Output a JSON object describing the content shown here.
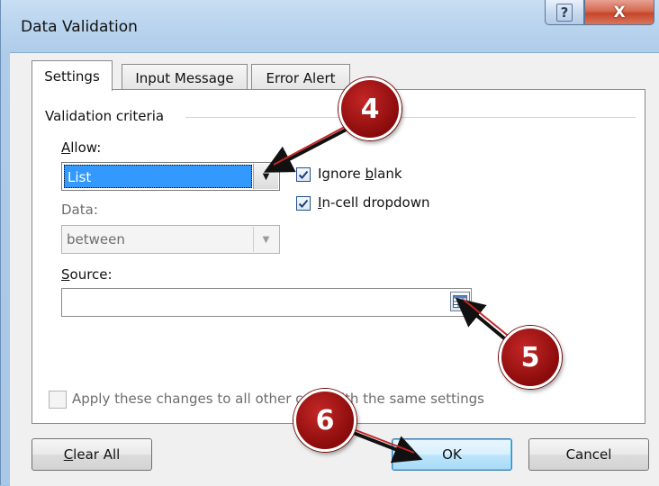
{
  "window": {
    "title": "Data Validation",
    "help_label": "?",
    "close_label": "X"
  },
  "tabs": [
    {
      "label": "Settings",
      "active": true
    },
    {
      "label": "Input Message",
      "active": false
    },
    {
      "label": "Error Alert",
      "active": false
    }
  ],
  "settings": {
    "group_title": "Validation criteria",
    "allow": {
      "label_pre": "",
      "label_u": "A",
      "label_post": "llow:",
      "value": "List"
    },
    "data": {
      "label": "Data:",
      "value": "between"
    },
    "ignore_blank": {
      "label_pre": "Ignore ",
      "label_u": "b",
      "label_post": "lank",
      "checked": true
    },
    "in_cell_dropdown": {
      "label_pre": "",
      "label_u": "I",
      "label_post": "n-cell dropdown",
      "checked": true
    },
    "source": {
      "label_pre": "",
      "label_u": "S",
      "label_post": "ource:",
      "value": ""
    },
    "apply_all": {
      "label": "Apply these changes to all other cells with the same settings",
      "checked": false
    }
  },
  "buttons": {
    "clear_all_u": "C",
    "clear_all_rest": "lear All",
    "ok": "OK",
    "cancel": "Cancel"
  },
  "callouts": {
    "four": "4",
    "five": "5",
    "six": "6"
  },
  "colors": {
    "callout": "#a11414",
    "selection": "#3399ff",
    "title_bar": "#b9d4ee"
  }
}
